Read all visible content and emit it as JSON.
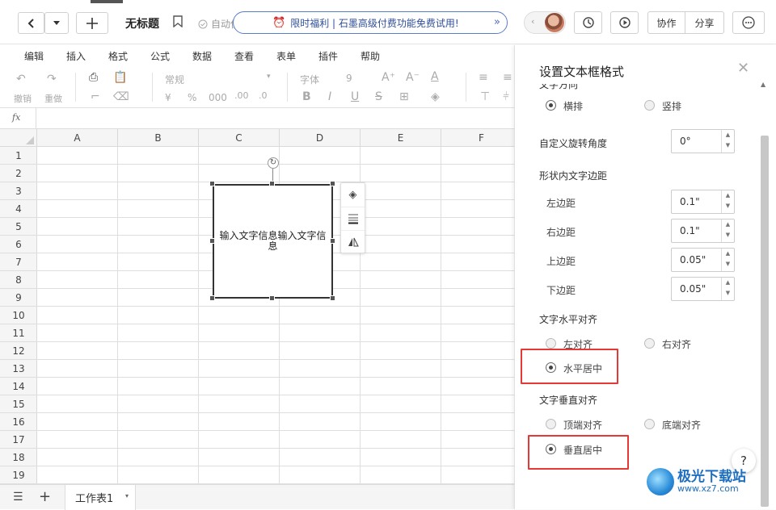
{
  "header": {
    "doc_title": "无标题",
    "autosave": "自动保存成功",
    "promo": "限时福利 | 石墨高级付费功能免费试用!",
    "collaborate": "协作",
    "share": "分享"
  },
  "menu": [
    "编辑",
    "插入",
    "格式",
    "公式",
    "数据",
    "查看",
    "表单",
    "插件",
    "帮助"
  ],
  "toolbar": {
    "undo": "撤销",
    "redo": "重做",
    "number_format": "常规",
    "font": "字体",
    "font_size": "9",
    "currency": "¥",
    "percent": "%",
    "thousands": "000"
  },
  "formula": {
    "fx": "fx"
  },
  "grid": {
    "columns": [
      "A",
      "B",
      "C",
      "D",
      "E",
      "F"
    ],
    "rows": [
      "1",
      "2",
      "3",
      "4",
      "5",
      "6",
      "7",
      "8",
      "9",
      "10",
      "11",
      "12",
      "13",
      "14",
      "15",
      "16",
      "17",
      "18",
      "19"
    ]
  },
  "textbox": {
    "text": "输入文字信息输入文字信息"
  },
  "sheets": {
    "active": "工作表1"
  },
  "panel": {
    "title": "设置文本框格式",
    "direction_section": "文字方向",
    "dir_horizontal": "横排",
    "dir_vertical": "竖排",
    "rotation_label": "自定义旋转角度",
    "rotation_value": "0°",
    "padding_section": "形状内文字边距",
    "left_label": "左边距",
    "left_value": "0.1\"",
    "right_label": "右边距",
    "right_value": "0.1\"",
    "top_label": "上边距",
    "top_value": "0.05\"",
    "bottom_label": "下边距",
    "bottom_value": "0.05\"",
    "halign_section": "文字水平对齐",
    "halign_left": "左对齐",
    "halign_right": "右对齐",
    "halign_center": "水平居中",
    "valign_section": "文字垂直对齐",
    "valign_top": "顶端对齐",
    "valign_bottom": "底端对齐",
    "valign_middle": "垂直居中",
    "help": "?"
  },
  "watermark": {
    "title": "极光下载站",
    "url": "www.xz7.com"
  },
  "colors": {
    "highlight": "#e53935",
    "promo_border": "#5a7dc8"
  }
}
